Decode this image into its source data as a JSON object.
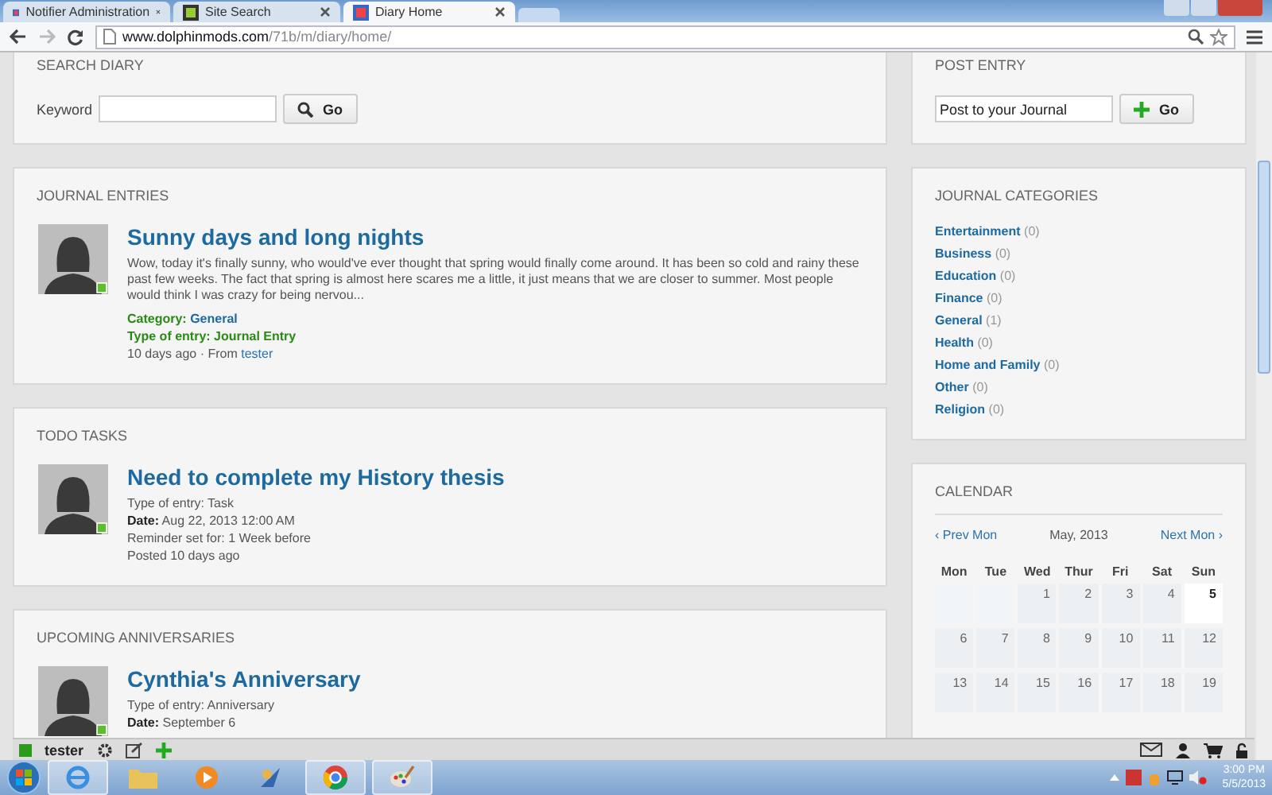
{
  "browser": {
    "tabs": [
      {
        "title": "Notifier Administration",
        "selected": false
      },
      {
        "title": "Site Search",
        "selected": false
      },
      {
        "title": "Diary Home",
        "selected": true
      }
    ],
    "url": {
      "domain": "www.dolphinmods.com",
      "path": "/71b/m/diary/home/"
    }
  },
  "search_diary": {
    "heading": "SEARCH DIARY",
    "label": "Keyword",
    "button": "Go"
  },
  "post_entry": {
    "heading": "POST ENTRY",
    "value": "Post to your Journal",
    "button": "Go"
  },
  "journal_entries": {
    "heading": "JOURNAL ENTRIES",
    "entries": [
      {
        "title": "Sunny days and long nights",
        "excerpt": "Wow, today it's finally sunny, who would've ever thought that spring would finally come around. It has been so cold and rainy these past few weeks. The fact that spring is almost here scares me a little, it just means that we are closer to summer. Most people would think I was crazy for being nervou...",
        "category_label": "Category:",
        "category": "General",
        "type": "Type of entry: Journal Entry",
        "age": "10 days ago",
        "from_label": "· From",
        "author": "tester"
      }
    ]
  },
  "todo_tasks": {
    "heading": "TODO TASKS",
    "tasks": [
      {
        "title": "Need to complete my History thesis",
        "type": "Type of entry: Task",
        "date_label": "Date:",
        "date": "Aug 22, 2013 12:00 AM",
        "reminder": "Reminder set for: 1 Week before",
        "posted": "Posted 10 days ago"
      }
    ]
  },
  "upcoming_anniversaries": {
    "heading": "UPCOMING ANNIVERSARIES",
    "items": [
      {
        "title": "Cynthia's Anniversary",
        "type": "Type of entry: Anniversary",
        "date_label": "Date:",
        "date": "September 6"
      }
    ]
  },
  "journal_categories": {
    "heading": "JOURNAL CATEGORIES",
    "items": [
      {
        "name": "Entertainment",
        "count": "(0)"
      },
      {
        "name": "Business",
        "count": "(0)"
      },
      {
        "name": "Education",
        "count": "(0)"
      },
      {
        "name": "Finance",
        "count": "(0)"
      },
      {
        "name": "General",
        "count": "(1)"
      },
      {
        "name": "Health",
        "count": "(0)"
      },
      {
        "name": "Home and Family",
        "count": "(0)"
      },
      {
        "name": "Other",
        "count": "(0)"
      },
      {
        "name": "Religion",
        "count": "(0)"
      }
    ]
  },
  "calendar": {
    "heading": "CALENDAR",
    "prev": "‹ Prev Mon",
    "month": "May, 2013",
    "next": "Next Mon ›",
    "weekdays": [
      "Mon",
      "Tue",
      "Wed",
      "Thur",
      "Fri",
      "Sat",
      "Sun"
    ],
    "weeks": [
      [
        {
          "kind": "blank"
        },
        {
          "kind": "blank"
        },
        {
          "kind": "day",
          "label": "1",
          "today": false
        },
        {
          "kind": "day",
          "label": "2",
          "today": false
        },
        {
          "kind": "day",
          "label": "3",
          "today": false
        },
        {
          "kind": "day",
          "label": "4",
          "today": false
        },
        {
          "kind": "day",
          "label": "5",
          "today": true
        }
      ],
      [
        {
          "kind": "day",
          "label": "6",
          "today": false
        },
        {
          "kind": "day",
          "label": "7",
          "today": false
        },
        {
          "kind": "day",
          "label": "8",
          "today": false
        },
        {
          "kind": "day",
          "label": "9",
          "today": false
        },
        {
          "kind": "day",
          "label": "10",
          "today": false
        },
        {
          "kind": "day",
          "label": "11",
          "today": false
        },
        {
          "kind": "day",
          "label": "12",
          "today": false
        }
      ],
      [
        {
          "kind": "day",
          "label": "13",
          "today": false
        },
        {
          "kind": "day",
          "label": "14",
          "today": false
        },
        {
          "kind": "day",
          "label": "15",
          "today": false
        },
        {
          "kind": "day",
          "label": "16",
          "today": false
        },
        {
          "kind": "day",
          "label": "17",
          "today": false
        },
        {
          "kind": "day",
          "label": "18",
          "today": false
        },
        {
          "kind": "day",
          "label": "19",
          "today": false
        }
      ]
    ]
  },
  "site_toolbar": {
    "user": "tester"
  },
  "taskbar": {
    "time": "3:00 PM",
    "date": "5/5/2013"
  }
}
